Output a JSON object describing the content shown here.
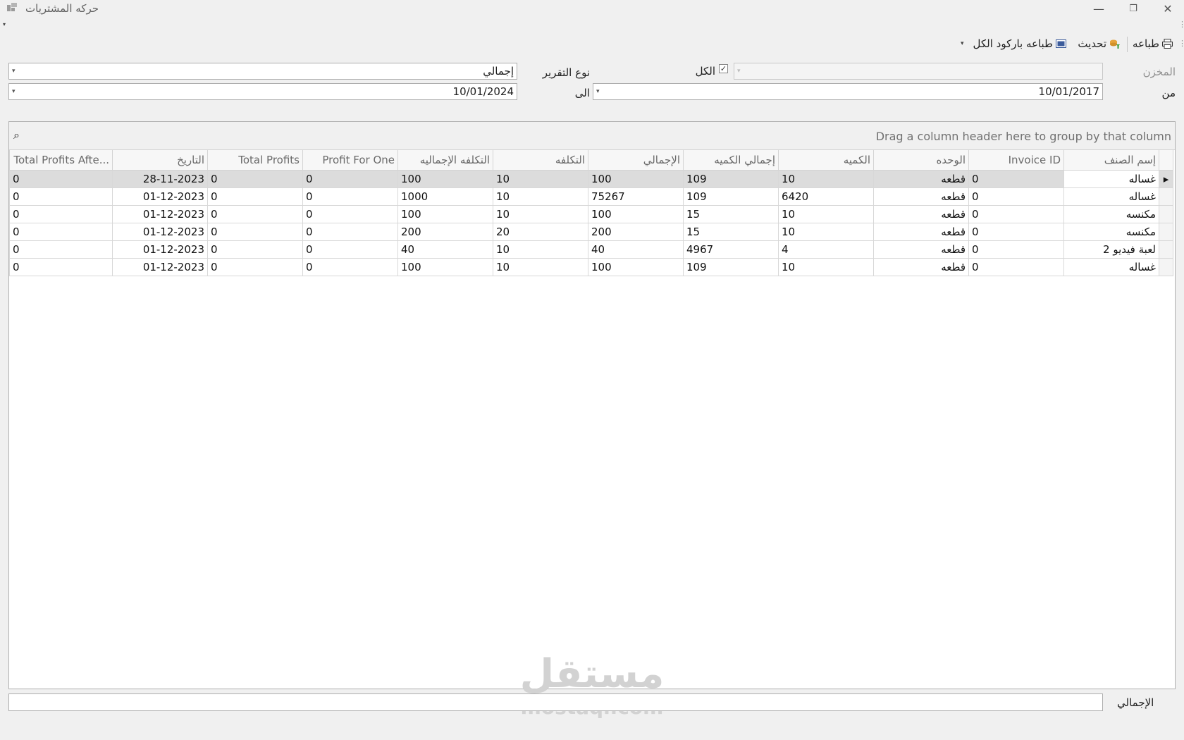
{
  "window": {
    "title": "حركه المشتريات",
    "minimize_glyph": "—",
    "restore_glyph": "❐",
    "close_glyph": "✕"
  },
  "toolbar": {
    "print_label": "طباعه",
    "print_icon": "printer-icon",
    "refresh_label": "تحديث",
    "refresh_icon": "refresh-icon",
    "barcode_label": "طباعه باركود الكل",
    "barcode_icon": "barcode-icon"
  },
  "filters": {
    "store_label": "المخزن",
    "store_value": "",
    "all_label": "الكل",
    "all_checked": true,
    "report_type_label": "نوع التقرير",
    "report_type_value": "إجمالي",
    "from_label": "من",
    "from_value": "10/01/2017",
    "to_label": "الى",
    "to_value": "10/01/2024"
  },
  "grid": {
    "group_panel_text": "Drag a column header here to group by that column",
    "columns": [
      "إسم الصنف",
      "Invoice ID",
      "الوحده",
      "الكميه",
      "إجمالي الكميه",
      "الإجمالي",
      "التكلفه",
      "التكلفه الإجماليه",
      "Profit For One",
      "Total Profits",
      "التاريخ",
      "Total Profits Afte..."
    ],
    "rows": [
      [
        "غساله",
        "0",
        "قطعه",
        "10",
        "109",
        "100",
        "10",
        "100",
        "0",
        "0",
        "28-11-2023",
        "0"
      ],
      [
        "غساله",
        "0",
        "قطعه",
        "6420",
        "109",
        "75267",
        "10",
        "1000",
        "0",
        "0",
        "01-12-2023",
        "0"
      ],
      [
        "مكنسه",
        "0",
        "قطعه",
        "10",
        "15",
        "100",
        "10",
        "100",
        "0",
        "0",
        "01-12-2023",
        "0"
      ],
      [
        "مكنسه",
        "0",
        "قطعه",
        "10",
        "15",
        "200",
        "20",
        "200",
        "0",
        "0",
        "01-12-2023",
        "0"
      ],
      [
        "لعبة فيديو 2",
        "0",
        "قطعه",
        "4",
        "4967",
        "40",
        "10",
        "40",
        "0",
        "0",
        "01-12-2023",
        "0"
      ],
      [
        "غساله",
        "0",
        "قطعه",
        "10",
        "109",
        "100",
        "10",
        "100",
        "0",
        "0",
        "01-12-2023",
        "0"
      ]
    ],
    "selected_row": 0
  },
  "footer": {
    "total_label": "الإجمالي",
    "total_value": ""
  },
  "watermark": {
    "arabic": "مستقل",
    "latin": "mostaqi.com"
  }
}
